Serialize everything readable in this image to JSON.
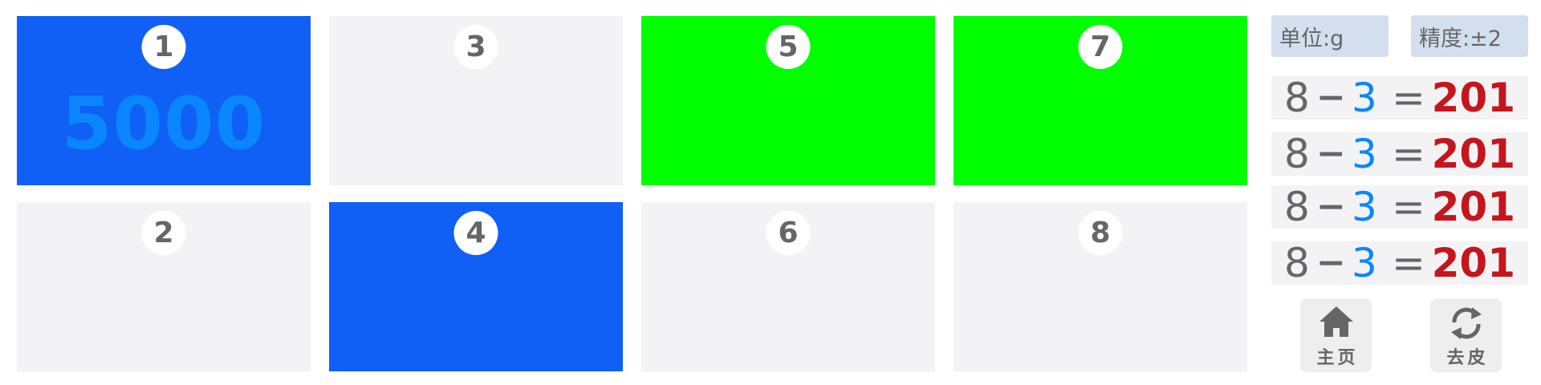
{
  "tiles": [
    {
      "number": "1",
      "value": "5000",
      "color": "#1060f6"
    },
    {
      "number": "2",
      "value": "",
      "color": "#f3f3f5"
    },
    {
      "number": "3",
      "value": "",
      "color": "#f3f3f5"
    },
    {
      "number": "4",
      "value": "",
      "color": "#1060f6"
    },
    {
      "number": "5",
      "value": "",
      "color": "#00ff00"
    },
    {
      "number": "6",
      "value": "",
      "color": "#f3f3f5"
    },
    {
      "number": "7",
      "value": "",
      "color": "#00ff00"
    },
    {
      "number": "8",
      "value": "",
      "color": "#f3f3f5"
    }
  ],
  "info": {
    "unit": "单位:g",
    "precision": "精度:±2"
  },
  "equations": [
    {
      "a": "8",
      "op": "−",
      "b": "3",
      "eq": "=",
      "result": "201"
    },
    {
      "a": "8",
      "op": "−",
      "b": "3",
      "eq": "=",
      "result": "201"
    },
    {
      "a": "8",
      "op": "−",
      "b": "3",
      "eq": "=",
      "result": "201"
    },
    {
      "a": "8",
      "op": "−",
      "b": "3",
      "eq": "=",
      "result": "201"
    }
  ],
  "buttons": {
    "home": {
      "label": "主页",
      "icon": "home-icon"
    },
    "tare": {
      "label": "去皮",
      "icon": "refresh-icon"
    }
  },
  "colors": {
    "active_blue": "#1060f6",
    "active_green": "#00ff00",
    "inactive": "#f3f3f5",
    "value_blue": "#0a86ff",
    "result_red": "#c4161c"
  }
}
